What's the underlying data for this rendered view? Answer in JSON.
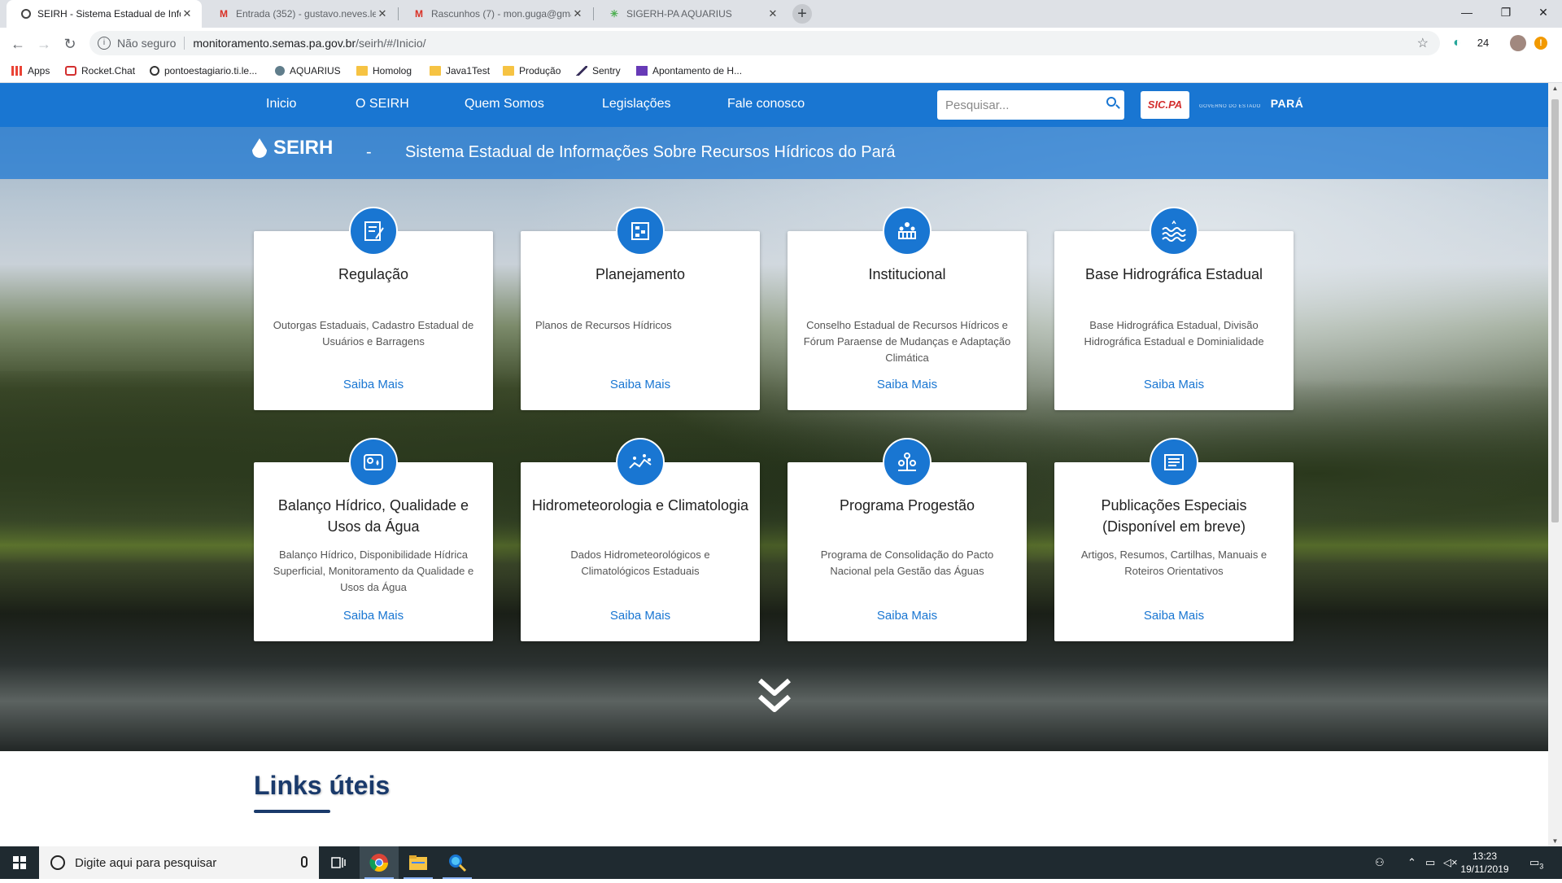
{
  "browser": {
    "tabs": [
      {
        "title": "SEIRH - Sistema Estadual de Info",
        "active": true
      },
      {
        "title": "Entrada (352) - gustavo.neves.le",
        "active": false
      },
      {
        "title": "Rascunhos (7) - mon.guga@gma",
        "active": false
      },
      {
        "title": "SIGERH-PA AQUARIUS",
        "active": false
      }
    ],
    "security_label": "Não seguro",
    "url_host": "monitoramento.semas.pa.gov.br",
    "url_path": "/seirh/#/Inicio/",
    "extension_count": "24",
    "bookmarks": [
      {
        "label": "Apps",
        "color": "#ea4335"
      },
      {
        "label": "Rocket.Chat",
        "color": "#d32f2f"
      },
      {
        "label": "pontoestagiario.ti.le...",
        "color": "#333333"
      },
      {
        "label": "AQUARIUS",
        "color": "#607d8b"
      },
      {
        "label": "Homolog",
        "color": "#f6c343"
      },
      {
        "label": "Java1Test",
        "color": "#f6c343"
      },
      {
        "label": "Produção",
        "color": "#f6c343"
      },
      {
        "label": "Sentry",
        "color": "#362d59"
      },
      {
        "label": "Apontamento de H...",
        "color": "#673ab7"
      }
    ]
  },
  "site": {
    "nav": [
      "Inicio",
      "O SEIRH",
      "Quem Somos",
      "Legislações",
      "Fale conosco"
    ],
    "search_placeholder": "Pesquisar...",
    "sicpa_logo": "SIC.PA",
    "gov_logo": "PARÁ",
    "banner_logo": "SEIRH",
    "banner_dash": "-",
    "banner_subtitle": "Sistema Estadual de Informações Sobre Recursos Hídricos do Pará",
    "cards": [
      {
        "title": "Regulação",
        "desc": "Outorgas Estaduais, Cadastro Estadual de Usuários e Barragens",
        "more": "Saiba Mais",
        "icon": "document-edit-icon"
      },
      {
        "title": "Planejamento",
        "desc": "Planos de Recursos Hídricos",
        "more": "Saiba Mais",
        "icon": "planning-board-icon"
      },
      {
        "title": "Institucional",
        "desc": "Conselho Estadual de Recursos Hídricos e Fórum Paraense de Mudanças e Adaptação Climática",
        "more": "Saiba Mais",
        "icon": "institution-people-icon"
      },
      {
        "title": "Base Hidrográfica Estadual",
        "desc": "Base Hidrográfica Estadual, Divisão Hidrográfica Estadual e Dominialidade",
        "more": "Saiba Mais",
        "icon": "water-waves-icon"
      },
      {
        "title": "Balanço Hídrico, Qualidade e Usos da Água",
        "desc": "Balanço Hídrico, Disponibilidade Hídrica Superficial, Monitoramento da Qualidade e Usos da Água",
        "more": "Saiba Mais",
        "icon": "water-balance-icon"
      },
      {
        "title": "Hidrometeorologia e Climatologia",
        "desc": "Dados Hidrometeorológicos e Climatológicos Estaduais",
        "more": "Saiba Mais",
        "icon": "hydrometeorology-icon"
      },
      {
        "title": "Programa Progestão",
        "desc": "Programa de Consolidação do Pacto Nacional pela Gestão das Águas",
        "more": "Saiba Mais",
        "icon": "program-network-icon"
      },
      {
        "title": "Publicações Especiais (Disponível em breve)",
        "desc": "Artigos, Resumos, Cartilhas, Manuais e Roteiros Orientativos",
        "more": "Saiba Mais",
        "icon": "publications-icon"
      }
    ],
    "links_title": "Links úteis"
  },
  "taskbar": {
    "search_placeholder": "Digite aqui para pesquisar",
    "time": "13:23",
    "date": "19/11/2019",
    "notification_count": "3"
  },
  "colors": {
    "primary": "#1976d2",
    "heading": "#1a3a6b"
  }
}
